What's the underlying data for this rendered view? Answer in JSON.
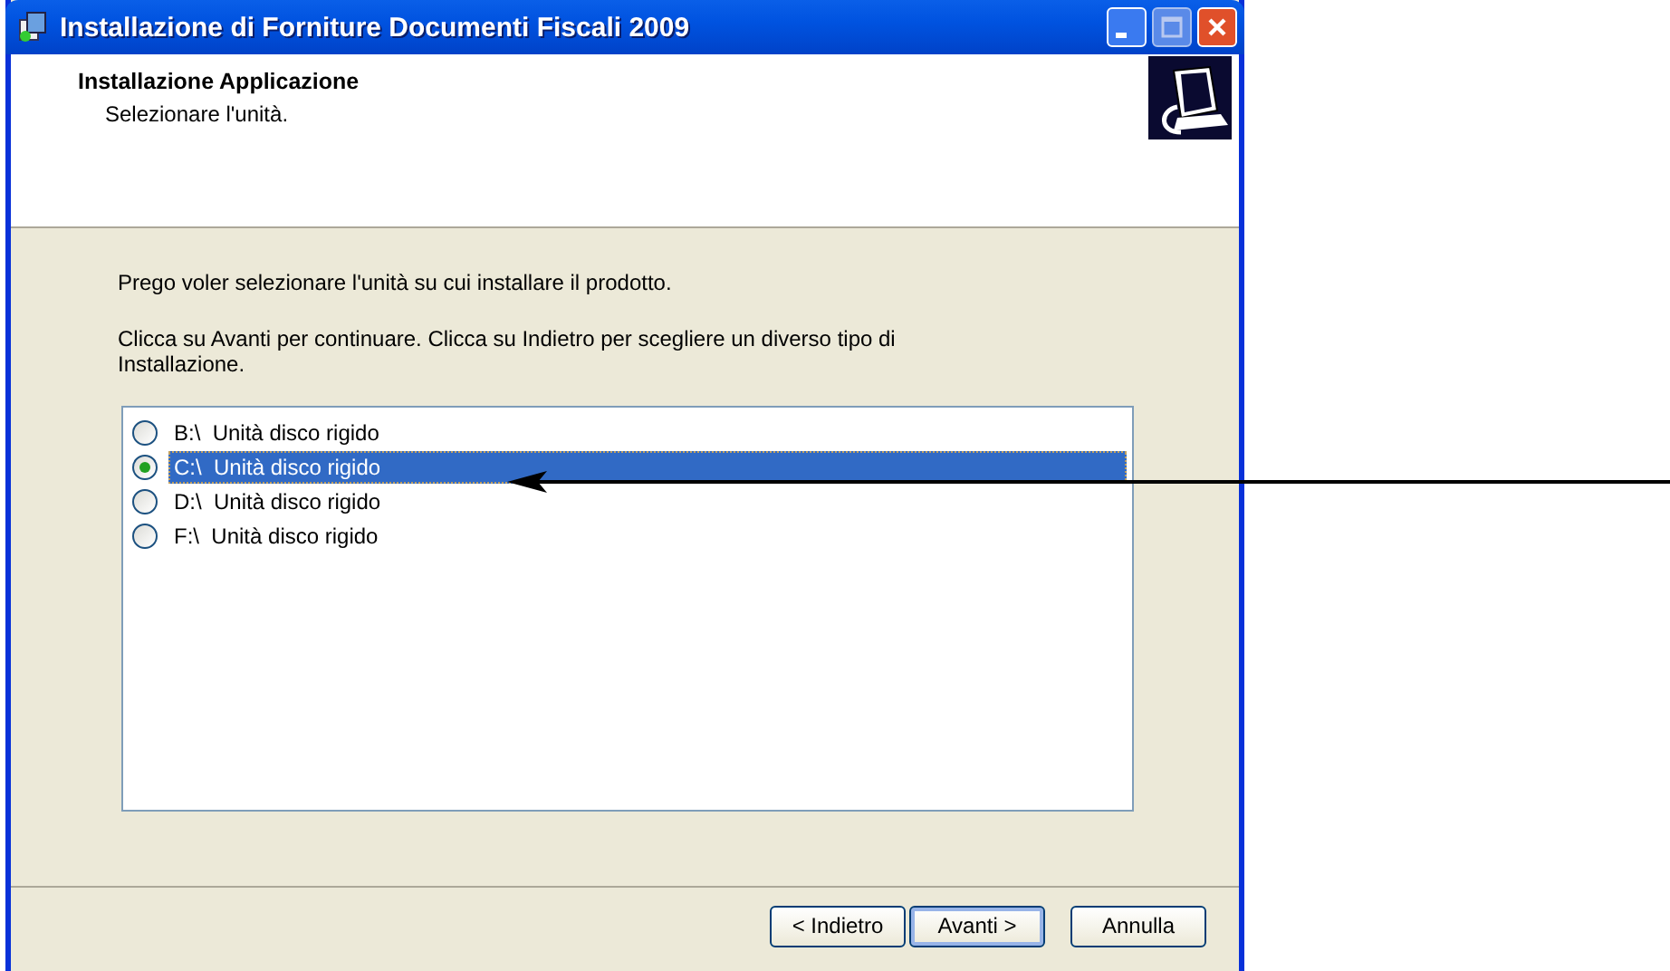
{
  "window": {
    "title": "Installazione di Forniture Documenti Fiscali 2009"
  },
  "header": {
    "title": "Installazione Applicazione",
    "subtitle": "Selezionare l'unità."
  },
  "instructions": [
    "Prego voler selezionare l'unità su cui installare il prodotto.",
    "Clicca su Avanti per continuare. Clicca su Indietro per scegliere un diverso tipo di Installazione."
  ],
  "drives": [
    {
      "label": "B:\\  Unità disco rigido",
      "selected": false
    },
    {
      "label": "C:\\  Unità disco rigido",
      "selected": true
    },
    {
      "label": "D:\\  Unità disco rigido",
      "selected": false
    },
    {
      "label": "F:\\  Unità disco rigido",
      "selected": false
    }
  ],
  "buttons": [
    {
      "label": "< Indietro",
      "default": false
    },
    {
      "label": "Avanti >",
      "default": true
    },
    {
      "label": "Annulla",
      "default": false
    }
  ],
  "annotation": {
    "kind": "arrow"
  }
}
